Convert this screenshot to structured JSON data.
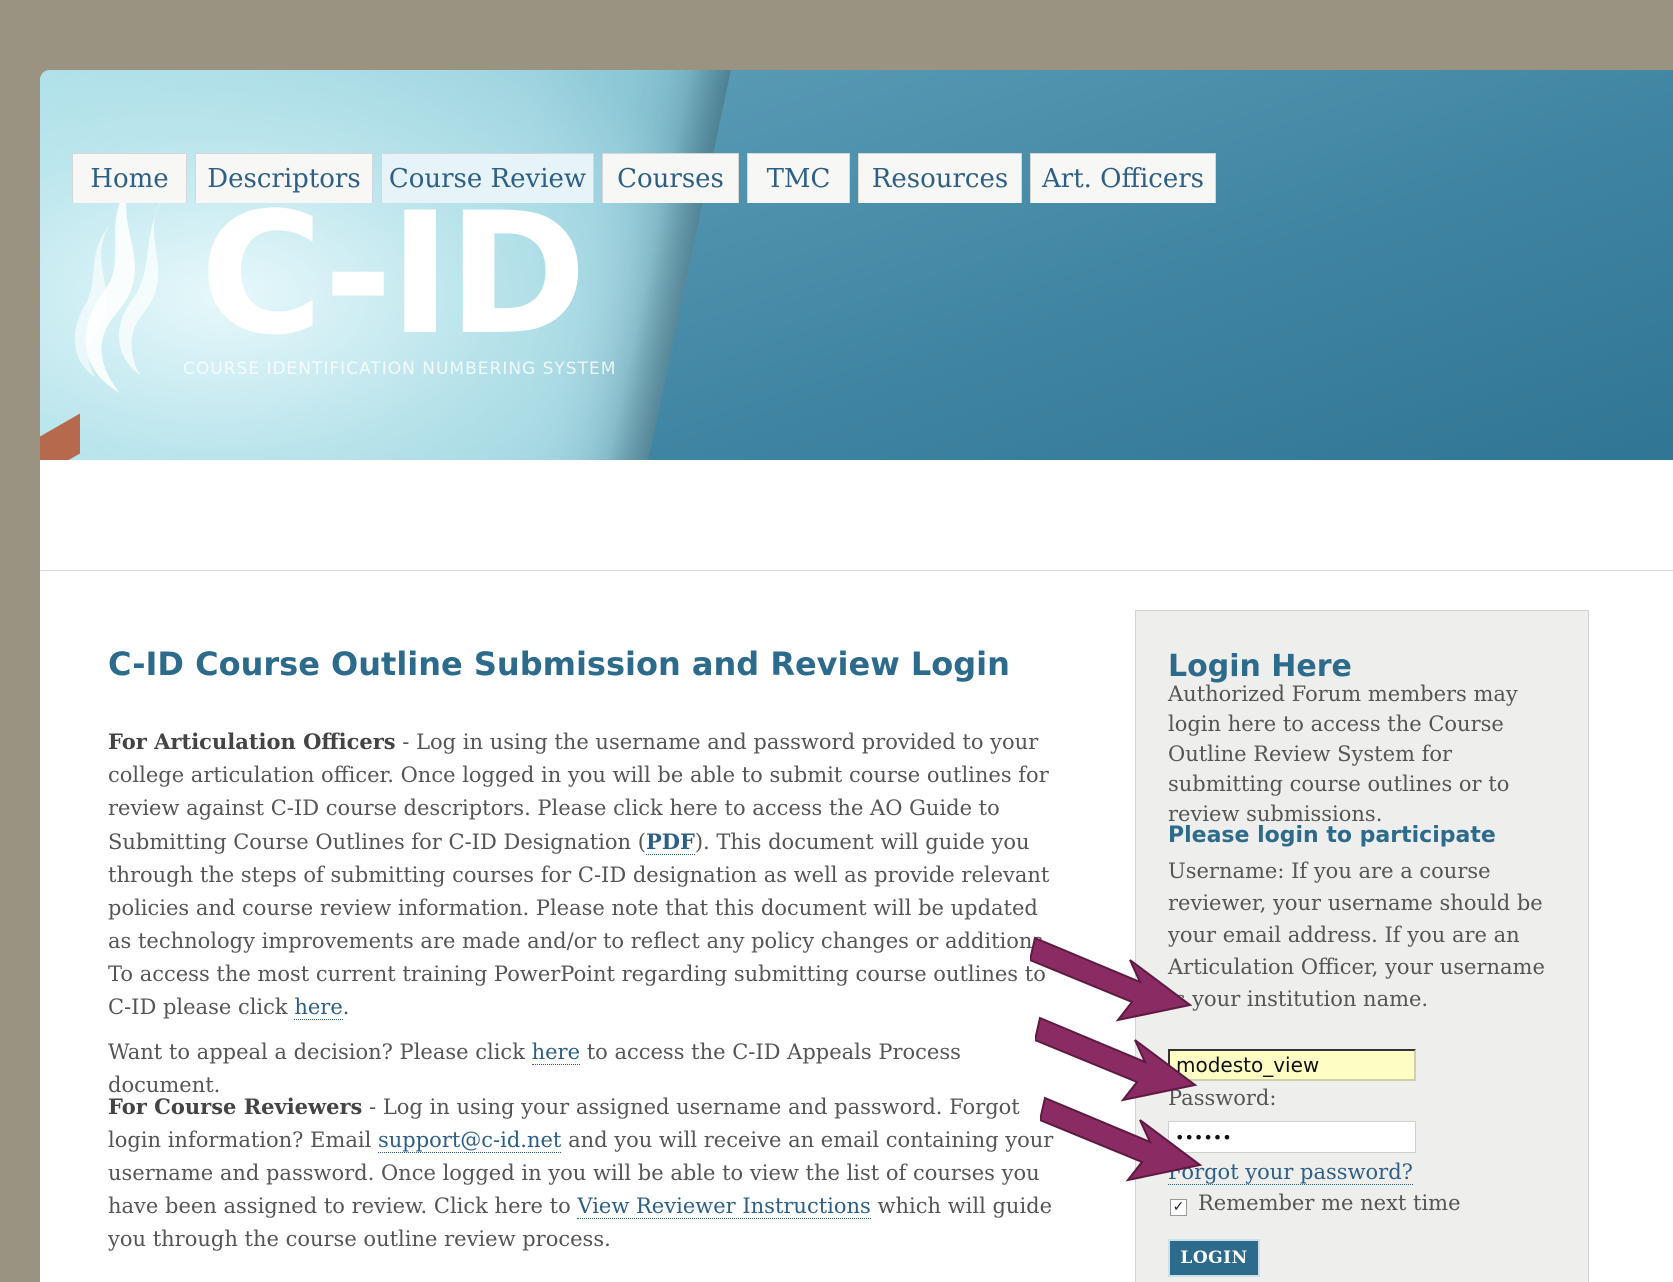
{
  "header": {
    "logo_text": "C-ID",
    "logo_subtitle": "COURSE IDENTIFICATION NUMBERING SYSTEM"
  },
  "nav": {
    "tabs": [
      {
        "label": "Home"
      },
      {
        "label": "Descriptors"
      },
      {
        "label": "Course Review",
        "active": true
      },
      {
        "label": "Courses"
      },
      {
        "label": "TMC"
      },
      {
        "label": "Resources"
      },
      {
        "label": "Art. Officers"
      }
    ]
  },
  "main": {
    "title": "C-ID Course Outline Submission and Review Login",
    "ao_heading": "For Articulation Officers",
    "ao_text_1": " - Log in using the username and password provided to your college articulation officer. Once logged in you will be able to submit course outlines for review against C-ID course descriptors. Please click here to access the AO Guide to Submitting Course Outlines for C-ID Designation (",
    "ao_pdf_link": "PDF",
    "ao_text_2": "). This document will guide you through the steps of submitting courses for C-ID designation as well as provide relevant policies and course review information. Please note that this document will be updated as technology improvements are made and/or to reflect any policy changes or additions. To access the most current training PowerPoint regarding submitting course outlines to C-ID please click ",
    "ao_here_link": "here",
    "ao_text_3": ".",
    "appeal_text_1": "Want to appeal a decision? Please click ",
    "appeal_here_link": "here",
    "appeal_text_2": " to access the C-ID Appeals Process document.",
    "reviewer_heading": "For Course Reviewers",
    "reviewer_text_1": " - Log in using your assigned username and password. Forgot login information? Email ",
    "reviewer_email_link": "support@c-id.net",
    "reviewer_text_2": " and you will receive an email containing your username and password. Once logged in you will be able to view the list of courses you have been assigned to review. Click here to ",
    "reviewer_instructions_link": "View Reviewer Instructions",
    "reviewer_text_3": " which will guide you through the course outline review process."
  },
  "login": {
    "title": "Login Here",
    "intro": "Authorized Forum members may login here to access the Course Outline Review System for submitting course outlines or to review submissions.",
    "subtitle": "Please login to participate",
    "username_help": "Username: If you are a course reviewer, your username should be your email address. If you are an Articulation Officer, your username is your institution name.",
    "username_value": "modesto_view",
    "password_label": "Password:",
    "password_value": "••••••",
    "forgot_link": "Forgot your password?",
    "remember_checked": true,
    "remember_label": "Remember me next time",
    "login_button": "LOGIN"
  },
  "colors": {
    "accent": "#2d6b8c",
    "arrow": "#8a2b63",
    "page_background": "#9b9381"
  },
  "icons": {
    "logo_mark": "flame-swoosh-icon",
    "annotation": "arrow-icon",
    "checkbox": "checkmark-icon"
  }
}
